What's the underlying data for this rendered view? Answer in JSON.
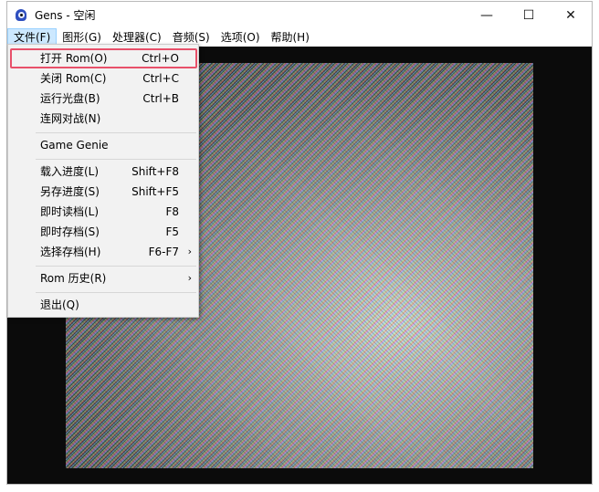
{
  "window": {
    "title": "Gens - 空闲",
    "controls": {
      "minimize": "—",
      "maximize": "☐",
      "close": "✕"
    }
  },
  "menubar": {
    "items": [
      {
        "label": "文件(F)"
      },
      {
        "label": "图形(G)"
      },
      {
        "label": "处理器(C)"
      },
      {
        "label": "音频(S)"
      },
      {
        "label": "选项(O)"
      },
      {
        "label": "帮助(H)"
      }
    ]
  },
  "file_menu": {
    "items": [
      {
        "label": "打开 Rom(O)",
        "shortcut": "Ctrl+O"
      },
      {
        "label": "关闭 Rom(C)",
        "shortcut": "Ctrl+C"
      },
      {
        "label": "运行光盘(B)",
        "shortcut": "Ctrl+B"
      },
      {
        "label": "连网对战(N)",
        "shortcut": ""
      },
      {
        "label": "Game Genie",
        "shortcut": ""
      },
      {
        "label": "载入进度(L)",
        "shortcut": "Shift+F8"
      },
      {
        "label": "另存进度(S)",
        "shortcut": "Shift+F5"
      },
      {
        "label": "即时读档(L)",
        "shortcut": "F8"
      },
      {
        "label": "即时存档(S)",
        "shortcut": "F5"
      },
      {
        "label": "选择存档(H)",
        "shortcut": "F6-F7"
      },
      {
        "label": "Rom 历史(R)",
        "shortcut": ""
      },
      {
        "label": "退出(Q)",
        "shortcut": ""
      }
    ],
    "submenu_arrow": "›"
  },
  "colors": {
    "menu_active_bg": "#cce8ff",
    "highlight_outline": "#e8506a",
    "client_bg": "#0b0b0b"
  }
}
